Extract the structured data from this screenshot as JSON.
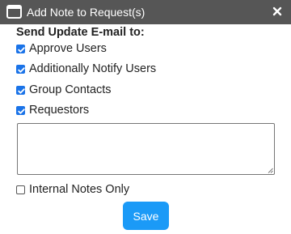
{
  "dialog": {
    "title": "Add Note to Request(s)",
    "close_icon": "close-icon",
    "window_icon": "window-icon"
  },
  "update_email": {
    "heading": "Send Update E-mail to:",
    "options": [
      {
        "label": "Approve Users",
        "checked": true
      },
      {
        "label": "Additionally Notify Users",
        "checked": true
      },
      {
        "label": "Group Contacts",
        "checked": true
      },
      {
        "label": "Requestors",
        "checked": true
      }
    ]
  },
  "note": {
    "value": "",
    "placeholder": ""
  },
  "internal_notes": {
    "label": "Internal Notes Only",
    "checked": false
  },
  "actions": {
    "save_label": "Save"
  },
  "colors": {
    "titlebar": "#565656",
    "checkbox_accent": "#1a73e8",
    "save_button": "#1b9af7"
  }
}
